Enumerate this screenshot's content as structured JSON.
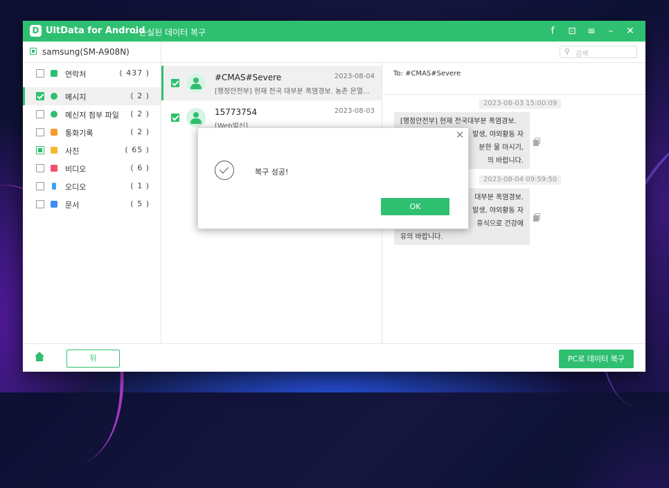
{
  "app": {
    "name": "UltData for Android",
    "subtitle": "- 손실된 데이터 복구",
    "logo_letter": "D",
    "accent_color": "#2fbf71",
    "titlebar_icons": [
      "facebook-icon",
      "feedback-icon",
      "menu-icon",
      "minimize-icon",
      "close-icon"
    ],
    "titlebar_glyphs": [
      "f",
      "⊡",
      "≡",
      "–",
      "✕"
    ]
  },
  "device": {
    "name": "samsung(SM-A908N)"
  },
  "search": {
    "placeholder": "검색",
    "icon": "search-icon"
  },
  "categories": [
    {
      "label": "연락처",
      "count": "( 437 )",
      "icon": "contacts-icon",
      "color": "#2fbf71",
      "state": "unchecked"
    },
    {
      "label": "메시지",
      "count": "( 2 )",
      "icon": "message-icon",
      "color": "#2fbf71",
      "state": "checked",
      "active": true
    },
    {
      "label": "메신저 첨부 파일",
      "count": "( 2 )",
      "icon": "attachment-icon",
      "color": "#2fbf71",
      "state": "unchecked"
    },
    {
      "label": "통화기록",
      "count": "( 2 )",
      "icon": "call-log-icon",
      "color": "#f39b2b",
      "state": "unchecked"
    },
    {
      "label": "사진",
      "count": "( 65 )",
      "icon": "photo-icon",
      "color": "#f5b82e",
      "state": "partial"
    },
    {
      "label": "비디오",
      "count": "( 6 )",
      "icon": "video-icon",
      "color": "#f0506e",
      "state": "unchecked"
    },
    {
      "label": "오디오",
      "count": "( 1 )",
      "icon": "audio-icon",
      "color": "#3fa3f2",
      "state": "unchecked"
    },
    {
      "label": "문서",
      "count": "( 5 )",
      "icon": "document-icon",
      "color": "#3d8ef5",
      "state": "unchecked"
    }
  ],
  "messages": [
    {
      "title": "#CMAS#Severe",
      "date": "2023-08-04",
      "preview": "[행정안전부] 현재 전국 대부분 폭염경보. 농촌 온열...",
      "selected": true
    },
    {
      "title": "15773754",
      "date": "2023-08-03",
      "preview": "[Web발신]",
      "selected": false
    }
  ],
  "detail": {
    "to": "To: #CMAS#Severe",
    "threads": [
      {
        "timestamp": "2023-08-03 15:00:09",
        "lines": [
          "[행정안전부] 현재 전국대부분 폭염경보.",
          "발생, 야외활동 자",
          "분한 물 마시기,",
          "의 바랍니다."
        ]
      },
      {
        "timestamp": "2023-08-04 09:59:50",
        "lines": [
          " 대부분 폭염경보.",
          "발생, 야외활동 자",
          " 휴식으로 건강에",
          "유의 바랍니다."
        ]
      }
    ]
  },
  "footer": {
    "back_label": "뒤",
    "recover_label": "PC로 데이터 복구"
  },
  "dialog": {
    "message": "복구 성공!",
    "ok_label": "OK",
    "close_glyph": "✕"
  }
}
